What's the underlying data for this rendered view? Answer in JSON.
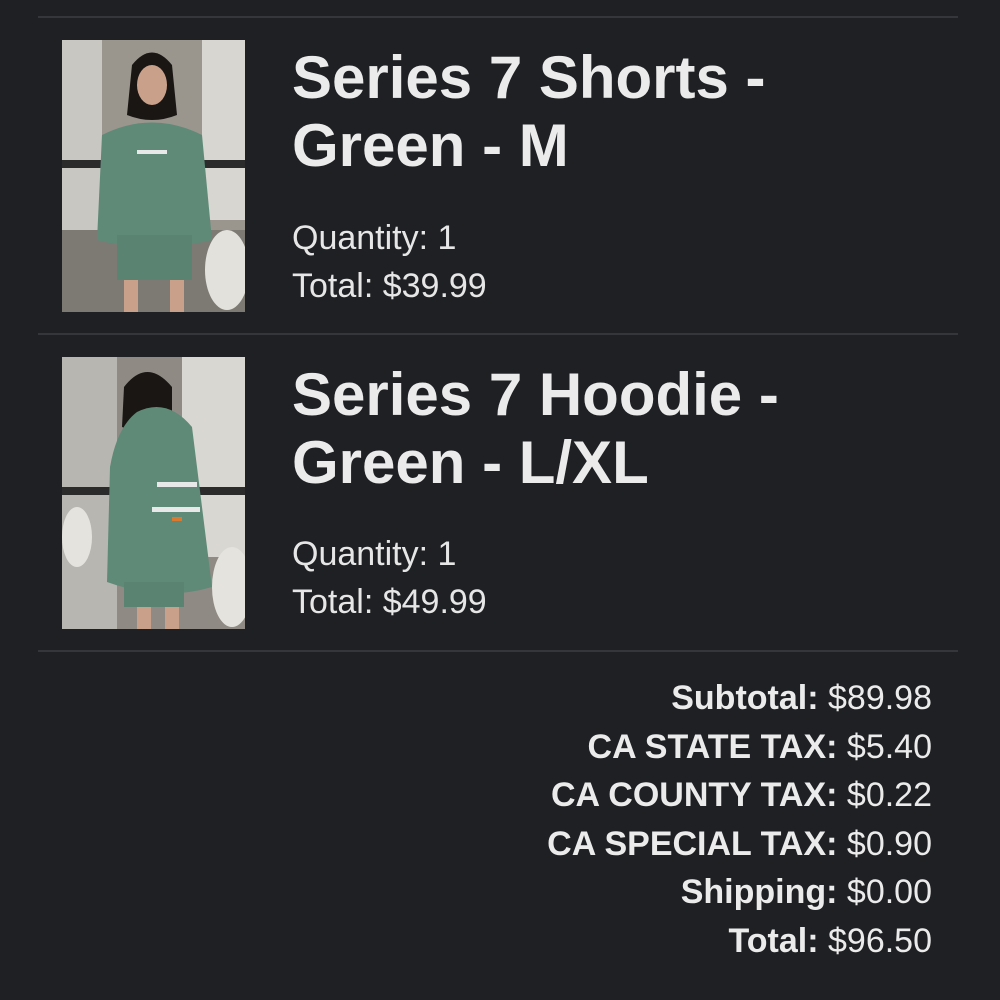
{
  "cart": {
    "items": [
      {
        "title_line1": "Series 7 Shorts -",
        "title_line2": "Green - M",
        "quantity_label": "Quantity:",
        "quantity": "1",
        "total_label": "Total:",
        "total": "$39.99",
        "image_icon": "product-photo-shorts"
      },
      {
        "title_line1": "Series 7 Hoodie -",
        "title_line2": "Green - L/XL",
        "quantity_label": "Quantity:",
        "quantity": "1",
        "total_label": "Total:",
        "total": "$49.99",
        "image_icon": "product-photo-hoodie"
      }
    ]
  },
  "summary": {
    "subtotal_label": "Subtotal:",
    "subtotal": "$89.98",
    "state_tax_label": "CA STATE TAX:",
    "state_tax": "$5.40",
    "county_tax_label": "CA COUNTY TAX:",
    "county_tax": "$0.22",
    "special_tax_label": "CA SPECIAL TAX:",
    "special_tax": "$0.90",
    "shipping_label": "Shipping:",
    "shipping": "$0.00",
    "total_label": "Total:",
    "total": "$96.50"
  },
  "colors": {
    "background": "#1f2023",
    "divider": "#34363b",
    "text": "#e6e6e6",
    "garment_green": "#5f8a78"
  }
}
